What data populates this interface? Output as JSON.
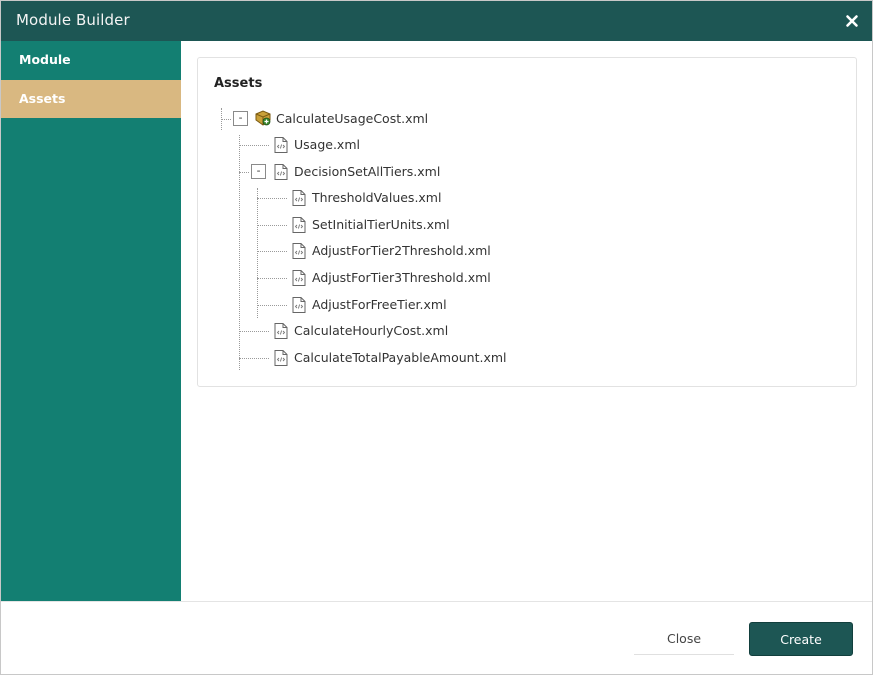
{
  "window": {
    "title": "Module Builder"
  },
  "sidebar": {
    "items": [
      {
        "label": "Module",
        "selected": false
      },
      {
        "label": "Assets",
        "selected": true
      }
    ]
  },
  "assets": {
    "title": "Assets",
    "tree": {
      "label": "CalculateUsageCost.xml",
      "icon": "rule-package-icon",
      "expanded": true,
      "toggle": "-",
      "children": [
        {
          "label": "Usage.xml",
          "icon": "xml-file-icon"
        },
        {
          "label": "DecisionSetAllTiers.xml",
          "icon": "xml-file-icon",
          "expanded": true,
          "toggle": "-",
          "children": [
            {
              "label": "ThresholdValues.xml",
              "icon": "xml-file-icon"
            },
            {
              "label": "SetInitialTierUnits.xml",
              "icon": "xml-file-icon"
            },
            {
              "label": "AdjustForTier2Threshold.xml",
              "icon": "xml-file-icon"
            },
            {
              "label": "AdjustForTier3Threshold.xml",
              "icon": "xml-file-icon"
            },
            {
              "label": "AdjustForFreeTier.xml",
              "icon": "xml-file-icon"
            }
          ]
        },
        {
          "label": "CalculateHourlyCost.xml",
          "icon": "xml-file-icon"
        },
        {
          "label": "CalculateTotalPayableAmount.xml",
          "icon": "xml-file-icon"
        }
      ]
    }
  },
  "footer": {
    "close_label": "Close",
    "create_label": "Create"
  },
  "colors": {
    "titlebar": "#1d5654",
    "sidebar": "#137f72",
    "selected_nav": "#d9b881",
    "create_button": "#1d5654"
  }
}
